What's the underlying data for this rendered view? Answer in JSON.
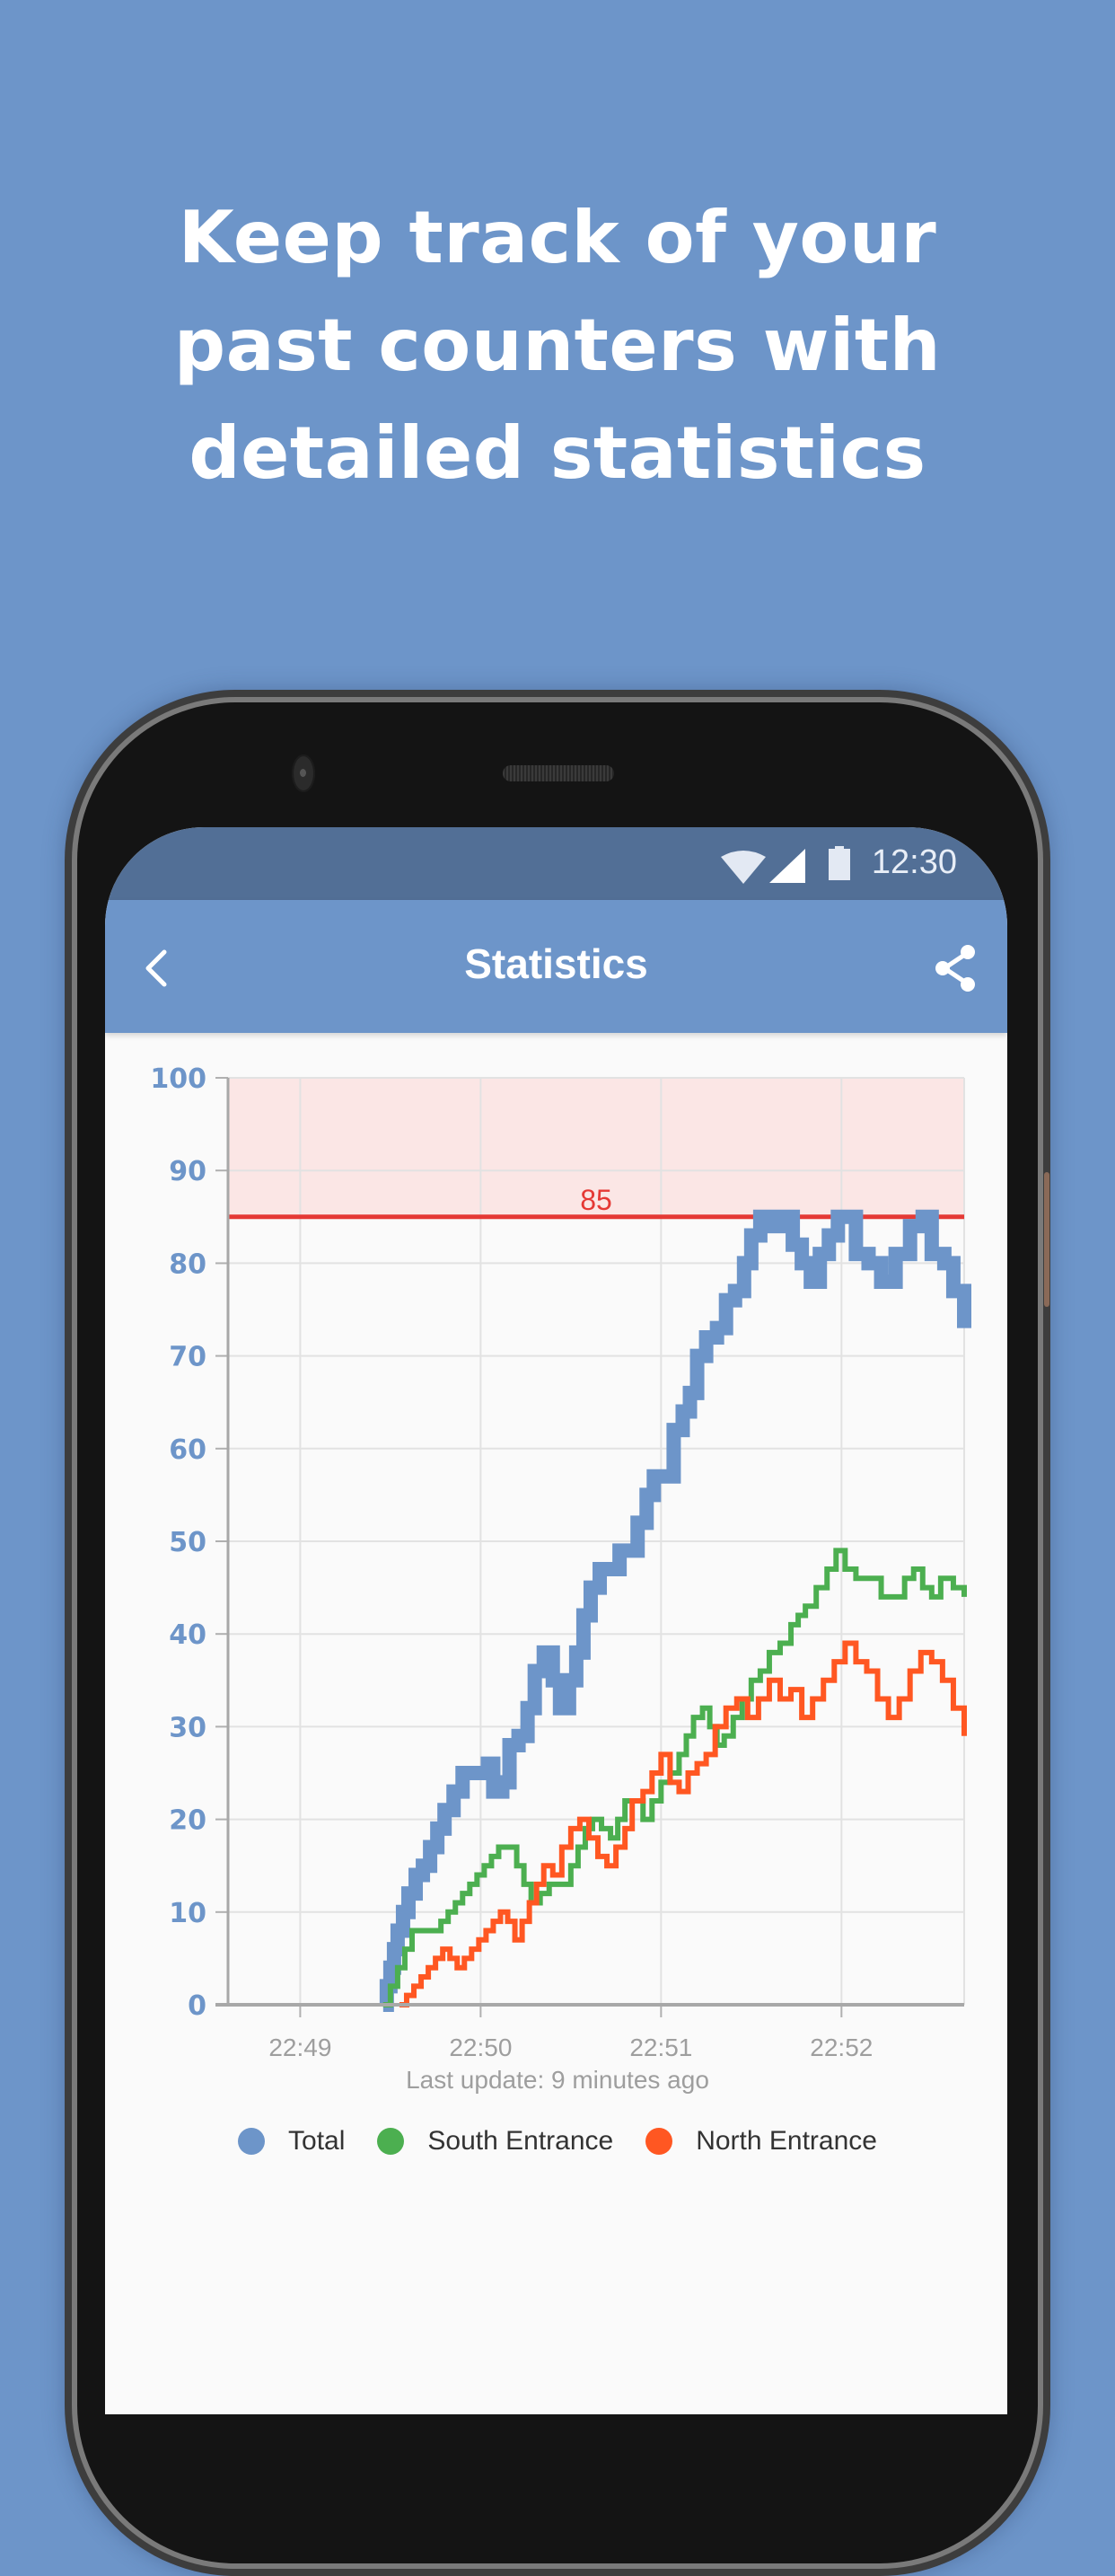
{
  "headline": {
    "lines": [
      "Keep track of your",
      "past counters with",
      "detailed statistics"
    ]
  },
  "statusbar": {
    "time": "12:30",
    "icons": [
      "wifi-icon",
      "signal-icon",
      "battery-icon"
    ]
  },
  "appbar": {
    "title": "Statistics",
    "back_icon": "chevron-left-icon",
    "share_icon": "share-icon"
  },
  "colors": {
    "background": "#6d95c9",
    "statusbar": "#526f96",
    "appbar": "#6d95c9",
    "total": "#6d95c9",
    "south": "#4caf50",
    "north": "#ff5722",
    "threshold": "#e53935",
    "threshold_zone": "#fbe6e5"
  },
  "footer": {
    "last_update": "Last update: 9 minutes ago"
  },
  "chart_data": {
    "type": "line",
    "step": true,
    "title": "",
    "xlabel": "",
    "ylabel": "",
    "x_unit": "minutes after 22:48",
    "xlim": [
      0.6,
      4.68
    ],
    "ylim": [
      0,
      100
    ],
    "yticks": [
      0,
      10,
      20,
      30,
      40,
      50,
      60,
      70,
      80,
      90,
      100
    ],
    "xticks": [
      {
        "value": 1,
        "label": "22:49"
      },
      {
        "value": 2,
        "label": "22:50"
      },
      {
        "value": 3,
        "label": "22:51"
      },
      {
        "value": 4,
        "label": "22:52"
      }
    ],
    "grid": true,
    "threshold": {
      "value": 85,
      "label": "85"
    },
    "legend_position": "bottom",
    "series": [
      {
        "name": "Total",
        "color": "#6d95c9",
        "points": [
          [
            1.46,
            0
          ],
          [
            1.48,
            2
          ],
          [
            1.5,
            4
          ],
          [
            1.52,
            6
          ],
          [
            1.54,
            8
          ],
          [
            1.57,
            10
          ],
          [
            1.6,
            12
          ],
          [
            1.64,
            14
          ],
          [
            1.68,
            15
          ],
          [
            1.72,
            17
          ],
          [
            1.76,
            19
          ],
          [
            1.8,
            21
          ],
          [
            1.85,
            23
          ],
          [
            1.9,
            25
          ],
          [
            2.0,
            25
          ],
          [
            2.04,
            26
          ],
          [
            2.07,
            23
          ],
          [
            2.12,
            24
          ],
          [
            2.16,
            28
          ],
          [
            2.21,
            29
          ],
          [
            2.26,
            32
          ],
          [
            2.3,
            36
          ],
          [
            2.35,
            38
          ],
          [
            2.4,
            35
          ],
          [
            2.44,
            32
          ],
          [
            2.49,
            35
          ],
          [
            2.53,
            38
          ],
          [
            2.57,
            42
          ],
          [
            2.61,
            45
          ],
          [
            2.66,
            47
          ],
          [
            2.72,
            47
          ],
          [
            2.77,
            49
          ],
          [
            2.83,
            49
          ],
          [
            2.87,
            52
          ],
          [
            2.92,
            55
          ],
          [
            2.96,
            57
          ],
          [
            3.03,
            57
          ],
          [
            3.07,
            62
          ],
          [
            3.12,
            64
          ],
          [
            3.16,
            66
          ],
          [
            3.2,
            70
          ],
          [
            3.25,
            72
          ],
          [
            3.31,
            73
          ],
          [
            3.36,
            76
          ],
          [
            3.41,
            77
          ],
          [
            3.46,
            80
          ],
          [
            3.5,
            83
          ],
          [
            3.55,
            85
          ],
          [
            3.62,
            84
          ],
          [
            3.68,
            85
          ],
          [
            3.73,
            82
          ],
          [
            3.78,
            80
          ],
          [
            3.83,
            78
          ],
          [
            3.88,
            81
          ],
          [
            3.93,
            83
          ],
          [
            3.98,
            85
          ],
          [
            4.03,
            85
          ],
          [
            4.08,
            81
          ],
          [
            4.15,
            80
          ],
          [
            4.22,
            78
          ],
          [
            4.3,
            81
          ],
          [
            4.38,
            84
          ],
          [
            4.45,
            85
          ],
          [
            4.5,
            81
          ],
          [
            4.57,
            80
          ],
          [
            4.62,
            77
          ],
          [
            4.68,
            73
          ]
        ]
      },
      {
        "name": "South Entrance",
        "color": "#4caf50",
        "points": [
          [
            1.46,
            0
          ],
          [
            1.5,
            2
          ],
          [
            1.54,
            4
          ],
          [
            1.58,
            6
          ],
          [
            1.62,
            8
          ],
          [
            1.74,
            8
          ],
          [
            1.78,
            9
          ],
          [
            1.82,
            10
          ],
          [
            1.86,
            11
          ],
          [
            1.9,
            12
          ],
          [
            1.94,
            13
          ],
          [
            1.98,
            14
          ],
          [
            2.02,
            15
          ],
          [
            2.06,
            16
          ],
          [
            2.1,
            17
          ],
          [
            2.16,
            17
          ],
          [
            2.2,
            15
          ],
          [
            2.24,
            13
          ],
          [
            2.28,
            11
          ],
          [
            2.33,
            12
          ],
          [
            2.38,
            13
          ],
          [
            2.45,
            13
          ],
          [
            2.5,
            15
          ],
          [
            2.54,
            17
          ],
          [
            2.58,
            19
          ],
          [
            2.62,
            20
          ],
          [
            2.67,
            19
          ],
          [
            2.72,
            18
          ],
          [
            2.76,
            20
          ],
          [
            2.8,
            22
          ],
          [
            2.86,
            22
          ],
          [
            2.9,
            20
          ],
          [
            2.95,
            22
          ],
          [
            3.0,
            24
          ],
          [
            3.05,
            25
          ],
          [
            3.1,
            27
          ],
          [
            3.14,
            29
          ],
          [
            3.18,
            31
          ],
          [
            3.23,
            32
          ],
          [
            3.27,
            30
          ],
          [
            3.31,
            28
          ],
          [
            3.35,
            29
          ],
          [
            3.4,
            31
          ],
          [
            3.45,
            33
          ],
          [
            3.5,
            35
          ],
          [
            3.55,
            36
          ],
          [
            3.6,
            38
          ],
          [
            3.66,
            39
          ],
          [
            3.72,
            41
          ],
          [
            3.76,
            42
          ],
          [
            3.8,
            43
          ],
          [
            3.86,
            45
          ],
          [
            3.92,
            47
          ],
          [
            3.97,
            49
          ],
          [
            4.02,
            47
          ],
          [
            4.08,
            46
          ],
          [
            4.16,
            46
          ],
          [
            4.22,
            44
          ],
          [
            4.3,
            44
          ],
          [
            4.35,
            46
          ],
          [
            4.4,
            47
          ],
          [
            4.45,
            45
          ],
          [
            4.5,
            44
          ],
          [
            4.55,
            46
          ],
          [
            4.62,
            45
          ],
          [
            4.68,
            44
          ]
        ]
      },
      {
        "name": "North Entrance",
        "color": "#ff5722",
        "points": [
          [
            1.55,
            0
          ],
          [
            1.59,
            1
          ],
          [
            1.63,
            2
          ],
          [
            1.67,
            3
          ],
          [
            1.71,
            4
          ],
          [
            1.75,
            5
          ],
          [
            1.79,
            6
          ],
          [
            1.83,
            5
          ],
          [
            1.87,
            4
          ],
          [
            1.91,
            5
          ],
          [
            1.95,
            6
          ],
          [
            1.99,
            7
          ],
          [
            2.03,
            8
          ],
          [
            2.07,
            9
          ],
          [
            2.11,
            10
          ],
          [
            2.15,
            9
          ],
          [
            2.19,
            7
          ],
          [
            2.23,
            9
          ],
          [
            2.27,
            11
          ],
          [
            2.31,
            13
          ],
          [
            2.35,
            15
          ],
          [
            2.4,
            14
          ],
          [
            2.45,
            17
          ],
          [
            2.5,
            19
          ],
          [
            2.55,
            20
          ],
          [
            2.6,
            18
          ],
          [
            2.65,
            16
          ],
          [
            2.7,
            15
          ],
          [
            2.75,
            17
          ],
          [
            2.8,
            19
          ],
          [
            2.84,
            22
          ],
          [
            2.9,
            23
          ],
          [
            2.95,
            25
          ],
          [
            3.0,
            27
          ],
          [
            3.05,
            24
          ],
          [
            3.1,
            23
          ],
          [
            3.15,
            25
          ],
          [
            3.2,
            26
          ],
          [
            3.25,
            27
          ],
          [
            3.3,
            30
          ],
          [
            3.36,
            32
          ],
          [
            3.42,
            33
          ],
          [
            3.48,
            31
          ],
          [
            3.54,
            33
          ],
          [
            3.6,
            35
          ],
          [
            3.66,
            33
          ],
          [
            3.72,
            34
          ],
          [
            3.78,
            31
          ],
          [
            3.84,
            33
          ],
          [
            3.9,
            35
          ],
          [
            3.96,
            37
          ],
          [
            4.02,
            39
          ],
          [
            4.08,
            37
          ],
          [
            4.14,
            36
          ],
          [
            4.2,
            33
          ],
          [
            4.26,
            31
          ],
          [
            4.32,
            33
          ],
          [
            4.38,
            36
          ],
          [
            4.44,
            38
          ],
          [
            4.5,
            37
          ],
          [
            4.56,
            35
          ],
          [
            4.62,
            32
          ],
          [
            4.68,
            29
          ]
        ]
      }
    ]
  }
}
